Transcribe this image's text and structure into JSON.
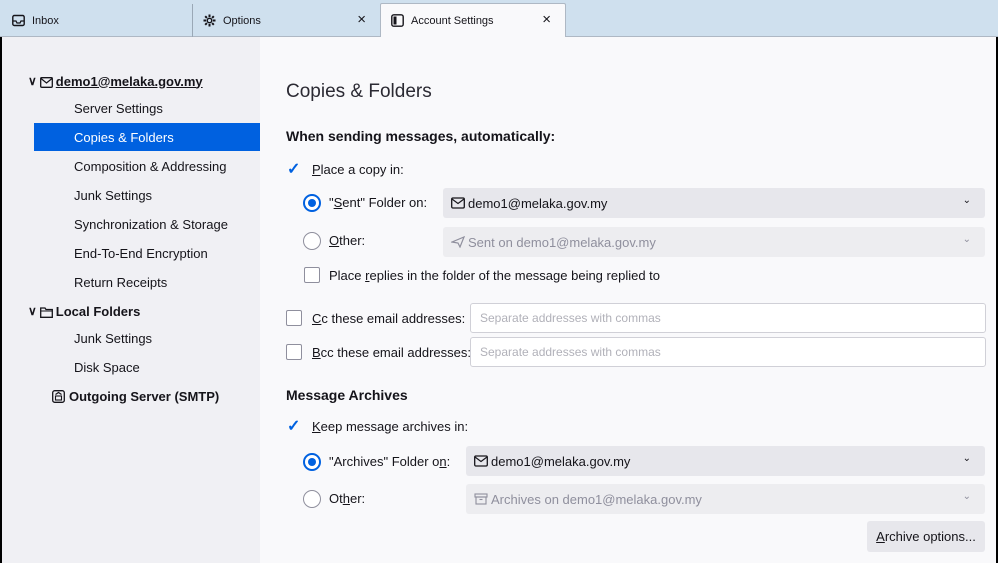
{
  "tabs": [
    {
      "label": "Inbox",
      "icon": "inbox-icon"
    },
    {
      "label": "Options",
      "icon": "gear-icon",
      "close": "×"
    },
    {
      "label": "Account Settings",
      "icon": "account-settings-icon",
      "close": "×"
    }
  ],
  "sidebar": {
    "account": {
      "label": "demo1@melaka.gov.my",
      "icon": "envelope-icon"
    },
    "account_items": [
      "Server Settings",
      "Copies & Folders",
      "Composition & Addressing",
      "Junk Settings",
      "Synchronization & Storage",
      "End-To-End Encryption",
      "Return Receipts"
    ],
    "selected": "Copies & Folders",
    "local": {
      "label": "Local Folders",
      "icon": "folder-icon"
    },
    "local_items": [
      "Junk Settings",
      "Disk Space"
    ],
    "smtp": {
      "label": "Outgoing Server (SMTP)",
      "icon": "smtp-server-icon"
    }
  },
  "main": {
    "title": "Copies & Folders",
    "sending_heading": "When sending messages, automatically:",
    "place_copy_label": "Place a copy in:",
    "sent_folder_label": "\"Sent\" Folder on:",
    "sent_folder_value": "demo1@melaka.gov.my",
    "other_label": "Other:",
    "other_value": "Sent on demo1@melaka.gov.my",
    "replies_label": "Place replies in the folder of the message being replied to",
    "cc_label": "Cc these email addresses:",
    "cc_placeholder": "Separate addresses with commas",
    "bcc_label": "Bcc these email addresses:",
    "bcc_placeholder": "Separate addresses with commas",
    "archives_heading": "Message Archives",
    "keep_archives_label": "Keep message archives in:",
    "archives_folder_label": "\"Archives\" Folder on:",
    "archives_folder_value": "demo1@melaka.gov.my",
    "other2_label": "Other:",
    "other2_value": "Archives on demo1@melaka.gov.my",
    "archive_options_button": "Archive options..."
  },
  "colors": {
    "accent": "#0061e0",
    "tabbar": "#cfe0ee",
    "sidebar": "#f0f0f4"
  }
}
